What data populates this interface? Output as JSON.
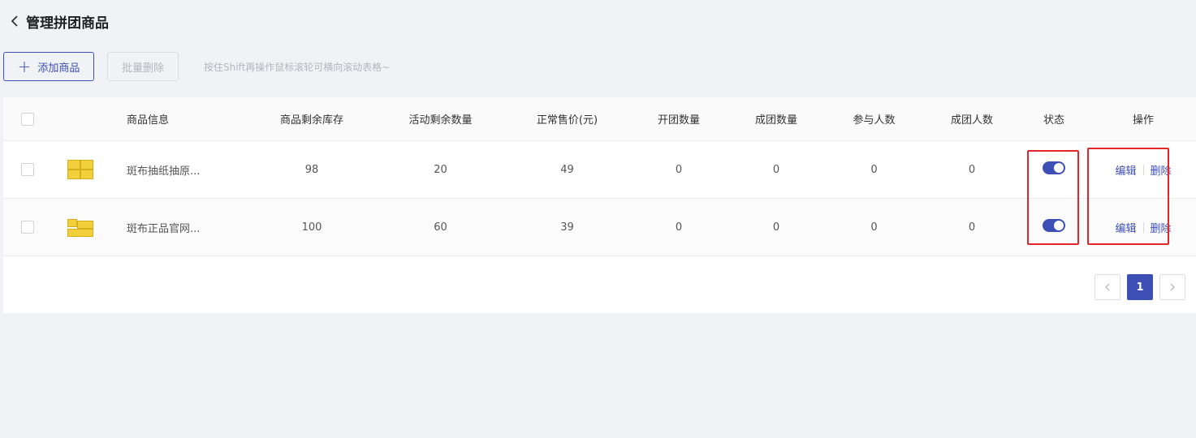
{
  "header": {
    "title": "管理拼团商品"
  },
  "toolbar": {
    "add_label": "添加商品",
    "batch_delete_label": "批量删除",
    "hint": "按住Shift再操作鼠标滚轮可横向滚动表格~"
  },
  "table": {
    "columns": [
      "商品信息",
      "商品剩余库存",
      "活动剩余数量",
      "正常售价(元)",
      "开团数量",
      "成团数量",
      "参与人数",
      "成团人数",
      "状态",
      "操作"
    ],
    "rows": [
      {
        "name": "斑布抽纸抽原...",
        "stock": "98",
        "remain": "20",
        "price": "49",
        "open": "0",
        "done": "0",
        "join": "0",
        "done_people": "0",
        "enabled": true,
        "edit": "编辑",
        "delete": "删除"
      },
      {
        "name": "斑布正品官网...",
        "stock": "100",
        "remain": "60",
        "price": "39",
        "open": "0",
        "done": "0",
        "join": "0",
        "done_people": "0",
        "enabled": true,
        "edit": "编辑",
        "delete": "删除"
      }
    ]
  },
  "pagination": {
    "current": "1"
  },
  "colors": {
    "accent": "#3d4fb5",
    "highlight": "#e4252a",
    "background": "#f1f2f6"
  }
}
